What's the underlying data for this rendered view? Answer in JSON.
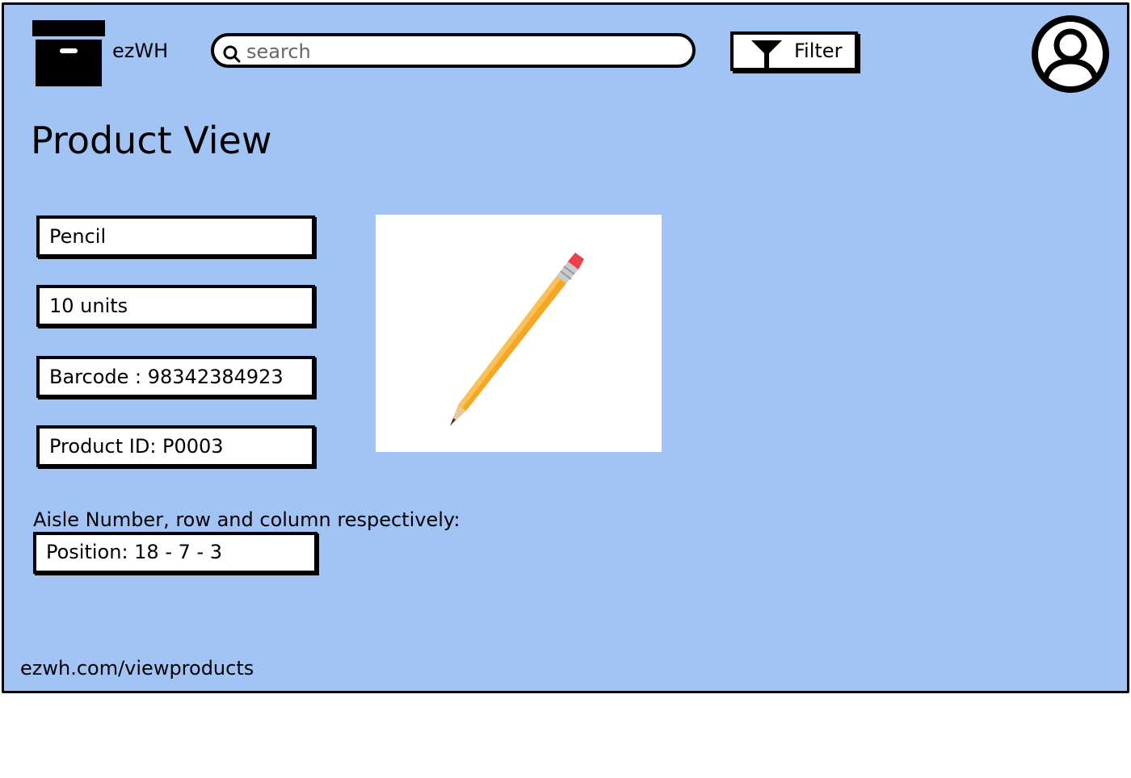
{
  "header": {
    "brand": "ezWH",
    "search": {
      "placeholder": "search",
      "value": ""
    },
    "filter_label": "Filter"
  },
  "icons": {
    "logo": "archive-box-icon",
    "search": "search-icon",
    "filter": "filter-funnel-icon",
    "avatar": "user-avatar-icon"
  },
  "page": {
    "title": "Product View"
  },
  "product": {
    "name": "Pencil",
    "quantity": "10 units",
    "barcode": "Barcode : 98342384923",
    "product_id": "Product ID: P0003",
    "aisle_label": "Aisle Number, row and column respectively:",
    "position": "Position: 18 - 7 - 3"
  },
  "footer": {
    "url": "ezwh.com/viewproducts"
  },
  "colors": {
    "background": "#a2c4f5",
    "border": "#000000",
    "field": "#ffffff",
    "pencil_body": "#f5a623",
    "pencil_eraser": "#e8414e"
  }
}
